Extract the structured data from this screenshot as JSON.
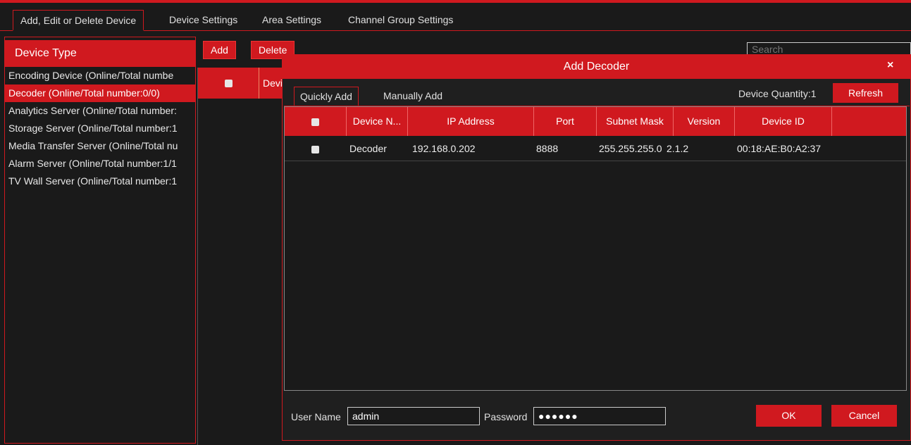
{
  "top_tabs": [
    {
      "label": "Add, Edit or Delete Device"
    },
    {
      "label": "Device Settings"
    },
    {
      "label": "Area Settings"
    },
    {
      "label": "Channel Group Settings"
    }
  ],
  "sidebar": {
    "header": "Device Type",
    "items": [
      {
        "label": "Encoding Device (Online/Total numbe"
      },
      {
        "label": "Decoder (Online/Total number:0/0)"
      },
      {
        "label": "Analytics Server (Online/Total number:"
      },
      {
        "label": "Storage Server (Online/Total number:1"
      },
      {
        "label": "Media Transfer Server (Online/Total nu"
      },
      {
        "label": "Alarm Server (Online/Total number:1/1"
      },
      {
        "label": "TV Wall Server (Online/Total number:1"
      }
    ]
  },
  "toolbar": {
    "add_label": "Add",
    "delete_label": "Delete",
    "search_placeholder": "Search"
  },
  "main_table": {
    "first_col_label": "Devi"
  },
  "dialog": {
    "title": "Add Decoder",
    "close_glyph": "×",
    "tabs": [
      {
        "label": "Quickly Add"
      },
      {
        "label": "Manually Add"
      }
    ],
    "device_quantity": "Device Quantity:1",
    "refresh_label": "Refresh",
    "columns": [
      "Device N...",
      "IP Address",
      "Port",
      "Subnet Mask",
      "Version",
      "Device ID"
    ],
    "rows": [
      {
        "name": "Decoder",
        "ip": "192.168.0.202",
        "port": "8888",
        "subnet": "255.255.255.0",
        "version": "2.1.2",
        "device_id": "00:18:AE:B0:A2:37"
      }
    ],
    "username_label": "User Name",
    "username_value": "admin",
    "password_label": "Password",
    "password_value": "●●●●●●",
    "ok_label": "OK",
    "cancel_label": "Cancel"
  },
  "colors": {
    "accent": "#d0191f",
    "background": "#1a1a1a"
  }
}
